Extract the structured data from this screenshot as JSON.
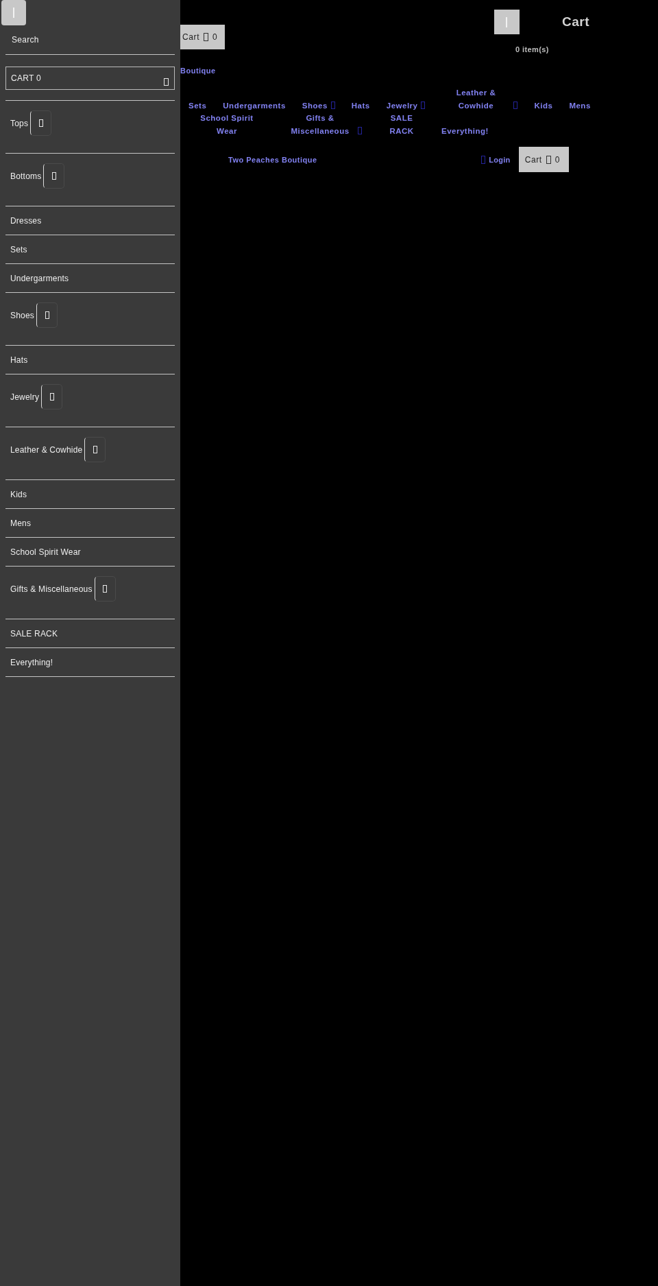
{
  "drawer": {
    "search": {
      "label": "Search"
    },
    "cart": {
      "label": "CART 0"
    },
    "items": [
      {
        "label": "Tops",
        "has_submenu": true
      },
      {
        "label": "Bottoms",
        "has_submenu": true
      },
      {
        "label": "Dresses",
        "has_submenu": false
      },
      {
        "label": "Sets",
        "has_submenu": false
      },
      {
        "label": "Undergarments",
        "has_submenu": false
      },
      {
        "label": "Shoes",
        "has_submenu": true
      },
      {
        "label": "Hats",
        "has_submenu": false
      },
      {
        "label": "Jewelry",
        "has_submenu": true
      },
      {
        "label": "Leather & Cowhide",
        "has_submenu": true
      },
      {
        "label": "Kids",
        "has_submenu": false
      },
      {
        "label": "Mens",
        "has_submenu": false
      },
      {
        "label": "School Spirit Wear",
        "has_submenu": false
      },
      {
        "label": "Gifts & Miscellaneous",
        "has_submenu": true
      },
      {
        "label": "SALE RACK",
        "has_submenu": false
      },
      {
        "label": "Everything!",
        "has_submenu": false
      }
    ]
  },
  "header": {
    "cart_button": {
      "label": "Cart",
      "count": "0"
    },
    "mini_cart": {
      "title": "Cart",
      "item_count": "0 item(s)"
    },
    "store_name": "Boutique"
  },
  "nav": {
    "items": [
      {
        "label": "Sets",
        "has_submenu": false
      },
      {
        "label": "Undergarments",
        "has_submenu": false
      },
      {
        "label": "Shoes",
        "has_submenu": true
      },
      {
        "label": "Hats",
        "has_submenu": false
      },
      {
        "label": "Jewelry",
        "has_submenu": true
      },
      {
        "label": "Leather & Cowhide",
        "has_submenu": true
      },
      {
        "label": "Kids",
        "has_submenu": false
      },
      {
        "label": "Mens",
        "has_submenu": false
      },
      {
        "label": "School Spirit Wear",
        "has_submenu": false
      },
      {
        "label": "Gifts & Miscellaneous",
        "has_submenu": true
      },
      {
        "label": "SALE RACK",
        "has_submenu": false
      },
      {
        "label": "Everything!",
        "has_submenu": false
      }
    ]
  },
  "utility_bar": {
    "store_name": "Two Peaches Boutique",
    "login": {
      "label": "Login"
    },
    "cart_button": {
      "label": "Cart",
      "count": "0"
    }
  }
}
